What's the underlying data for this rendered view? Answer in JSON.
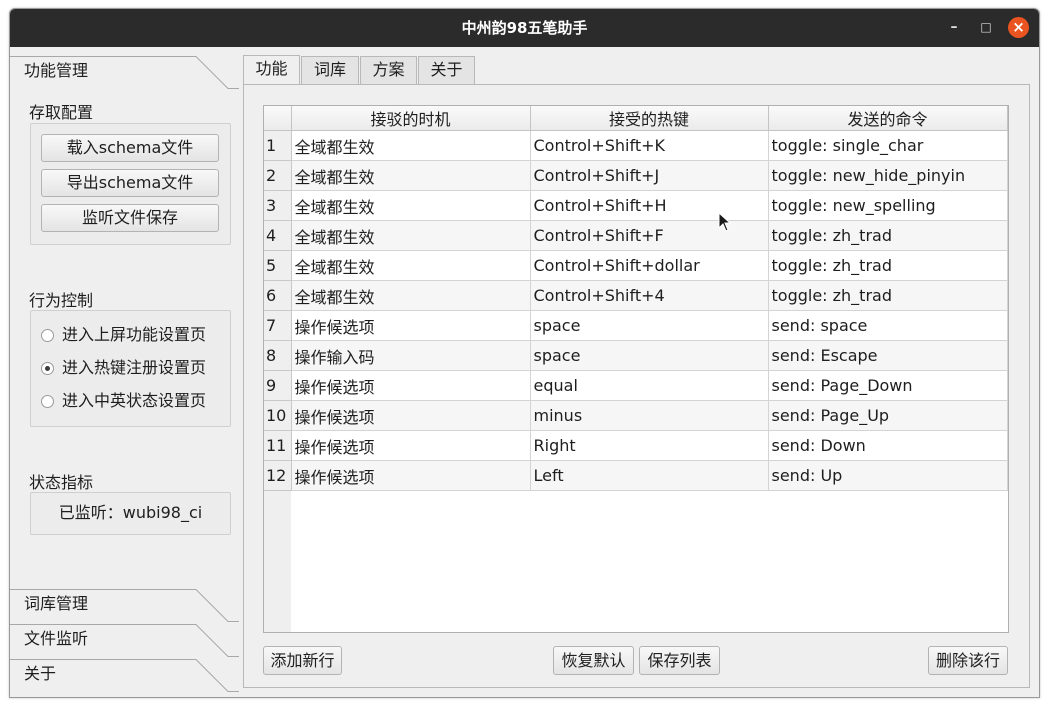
{
  "window": {
    "title": "中州韵98五笔助手"
  },
  "left_panel": {
    "sections": [
      {
        "label": "功能管理"
      },
      {
        "label": "词库管理"
      },
      {
        "label": "文件监听"
      },
      {
        "label": "关于"
      }
    ],
    "storage_group": {
      "title": "存取配置",
      "buttons": [
        "载入schema文件",
        "导出schema文件",
        "监听文件保存"
      ]
    },
    "behavior_group": {
      "title": "行为控制",
      "options": [
        {
          "label": "进入上屏功能设置页",
          "selected": false
        },
        {
          "label": "进入热键注册设置页",
          "selected": true
        },
        {
          "label": "进入中英状态设置页",
          "selected": false
        }
      ]
    },
    "status_group": {
      "title": "状态指标",
      "value": "已监听：wubi98_ci"
    }
  },
  "tabs": [
    {
      "label": "功能",
      "active": true
    },
    {
      "label": "词库",
      "active": false
    },
    {
      "label": "方案",
      "active": false
    },
    {
      "label": "关于",
      "active": false
    }
  ],
  "table": {
    "columns": [
      "接驳的时机",
      "接受的热键",
      "发送的命令"
    ],
    "rows": [
      {
        "n": "1",
        "when": "全域都生效",
        "key": "Control+Shift+K",
        "cmd": "toggle: single_char"
      },
      {
        "n": "2",
        "when": "全域都生效",
        "key": "Control+Shift+J",
        "cmd": "toggle: new_hide_pinyin"
      },
      {
        "n": "3",
        "when": "全域都生效",
        "key": "Control+Shift+H",
        "cmd": "toggle: new_spelling"
      },
      {
        "n": "4",
        "when": "全域都生效",
        "key": "Control+Shift+F",
        "cmd": "toggle: zh_trad"
      },
      {
        "n": "5",
        "when": "全域都生效",
        "key": "Control+Shift+dollar",
        "cmd": "toggle: zh_trad"
      },
      {
        "n": "6",
        "when": "全域都生效",
        "key": "Control+Shift+4",
        "cmd": "toggle: zh_trad"
      },
      {
        "n": "7",
        "when": "操作候选项",
        "key": "space",
        "cmd": "send: space"
      },
      {
        "n": "8",
        "when": "操作输入码",
        "key": "space",
        "cmd": "send: Escape"
      },
      {
        "n": "9",
        "when": "操作候选项",
        "key": "equal",
        "cmd": "send: Page_Down"
      },
      {
        "n": "10",
        "when": "操作候选项",
        "key": "minus",
        "cmd": "send: Page_Up"
      },
      {
        "n": "11",
        "when": "操作候选项",
        "key": "Right",
        "cmd": "send: Down"
      },
      {
        "n": "12",
        "when": "操作候选项",
        "key": "Left",
        "cmd": "send: Up"
      }
    ]
  },
  "actions": {
    "add_row": "添加新行",
    "restore_default": "恢复默认",
    "save_list": "保存列表",
    "delete_row": "删除该行"
  },
  "colors": {
    "titlebar": "#2b2b2b",
    "close_button": "#e95420",
    "window_bg": "#efefef"
  }
}
